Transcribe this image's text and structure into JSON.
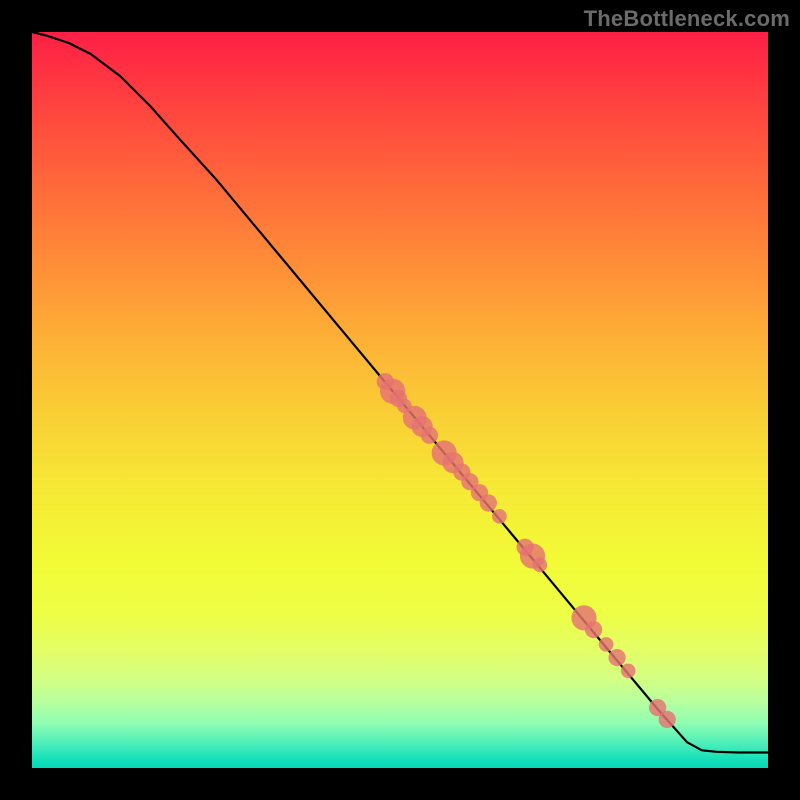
{
  "watermark": "TheBottleneck.com",
  "chart_data": {
    "type": "line",
    "title": "",
    "xlabel": "",
    "ylabel": "",
    "xlim": [
      0,
      100
    ],
    "ylim": [
      0,
      100
    ],
    "grid": false,
    "legend": false,
    "series": [
      {
        "name": "curve",
        "color": "#000000",
        "points": [
          {
            "x": 0,
            "y": 100
          },
          {
            "x": 2,
            "y": 99.5
          },
          {
            "x": 5,
            "y": 98.5
          },
          {
            "x": 8,
            "y": 97
          },
          {
            "x": 12,
            "y": 94
          },
          {
            "x": 16,
            "y": 90
          },
          {
            "x": 20,
            "y": 85.5
          },
          {
            "x": 25,
            "y": 80
          },
          {
            "x": 30,
            "y": 74
          },
          {
            "x": 35,
            "y": 68
          },
          {
            "x": 40,
            "y": 62
          },
          {
            "x": 45,
            "y": 56
          },
          {
            "x": 50,
            "y": 50
          },
          {
            "x": 55,
            "y": 44
          },
          {
            "x": 60,
            "y": 38
          },
          {
            "x": 65,
            "y": 32
          },
          {
            "x": 70,
            "y": 26
          },
          {
            "x": 75,
            "y": 20
          },
          {
            "x": 80,
            "y": 14
          },
          {
            "x": 85,
            "y": 8
          },
          {
            "x": 89,
            "y": 3.5
          },
          {
            "x": 91,
            "y": 2.4
          },
          {
            "x": 93,
            "y": 2.2
          },
          {
            "x": 96,
            "y": 2.1
          },
          {
            "x": 100,
            "y": 2.1
          }
        ]
      }
    ],
    "markers": [
      {
        "name": "cluster-top",
        "points": [
          {
            "x": 48,
            "y": 52.5,
            "r": 1.3
          },
          {
            "x": 49,
            "y": 51.2,
            "r": 1.9
          },
          {
            "x": 49.8,
            "y": 50.2,
            "r": 1.3
          },
          {
            "x": 50.6,
            "y": 49.2,
            "r": 1.1
          },
          {
            "x": 52,
            "y": 47.6,
            "r": 1.8
          },
          {
            "x": 53,
            "y": 46.4,
            "r": 1.6
          },
          {
            "x": 54,
            "y": 45.2,
            "r": 1.3
          }
        ]
      },
      {
        "name": "cluster-mid",
        "points": [
          {
            "x": 56,
            "y": 42.8,
            "r": 1.9
          },
          {
            "x": 57.2,
            "y": 41.5,
            "r": 1.6
          },
          {
            "x": 58.4,
            "y": 40.2,
            "r": 1.3
          },
          {
            "x": 59.5,
            "y": 38.9,
            "r": 1.3
          },
          {
            "x": 60.8,
            "y": 37.4,
            "r": 1.3
          },
          {
            "x": 62,
            "y": 36,
            "r": 1.3
          },
          {
            "x": 63.5,
            "y": 34.2,
            "r": 1.1
          }
        ]
      },
      {
        "name": "cluster-gap1",
        "points": [
          {
            "x": 67,
            "y": 30,
            "r": 1.3
          },
          {
            "x": 68,
            "y": 28.8,
            "r": 1.9
          },
          {
            "x": 69,
            "y": 27.6,
            "r": 1.1
          }
        ]
      },
      {
        "name": "cluster-low",
        "points": [
          {
            "x": 75,
            "y": 20.4,
            "r": 1.9
          },
          {
            "x": 76.3,
            "y": 18.8,
            "r": 1.3
          },
          {
            "x": 78,
            "y": 16.8,
            "r": 1.1
          },
          {
            "x": 79.5,
            "y": 15,
            "r": 1.3
          },
          {
            "x": 81,
            "y": 13.2,
            "r": 1.1
          }
        ]
      },
      {
        "name": "cluster-tail",
        "points": [
          {
            "x": 85,
            "y": 8.2,
            "r": 1.3
          },
          {
            "x": 86.3,
            "y": 6.6,
            "r": 1.3
          }
        ]
      }
    ]
  }
}
